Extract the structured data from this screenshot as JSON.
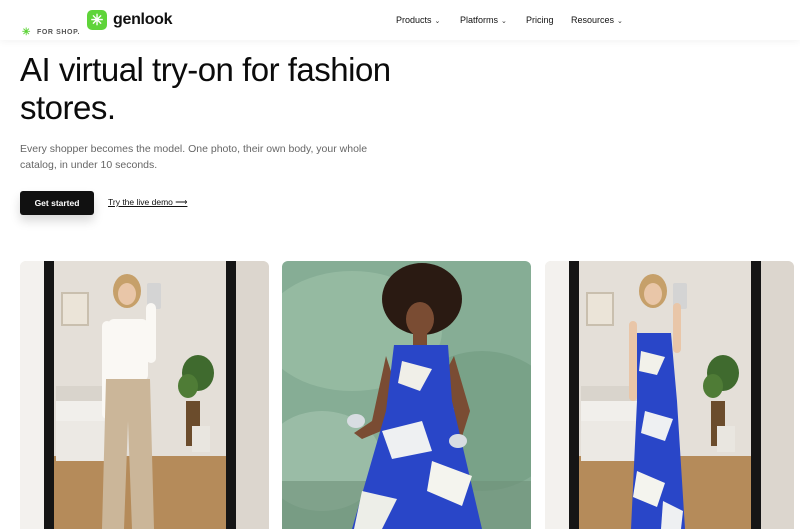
{
  "brand": {
    "name": "genlook",
    "logo_icon": "asterisk-icon",
    "accent": "#5fd43a"
  },
  "nav": {
    "products": "Products",
    "platforms": "Platforms",
    "pricing": "Pricing",
    "resources": "Resources"
  },
  "hero": {
    "eyebrow": "FOR SHOP.",
    "title_line1": "AI virtual try-on for fashion",
    "title_line2": "stores.",
    "subtitle_line1": "Every shopper becomes the model. One photo, their own body, your whole",
    "subtitle_line2": "catalog, in under 10 seconds.",
    "cta_primary": "Get started",
    "cta_secondary": "Try the live demo ⟶"
  },
  "gallery": {
    "images": [
      {
        "name": "mirror-selfie-white-top-trousers"
      },
      {
        "name": "model-blue-print-dress-green-wall"
      },
      {
        "name": "mirror-selfie-blue-print-dress"
      }
    ]
  }
}
